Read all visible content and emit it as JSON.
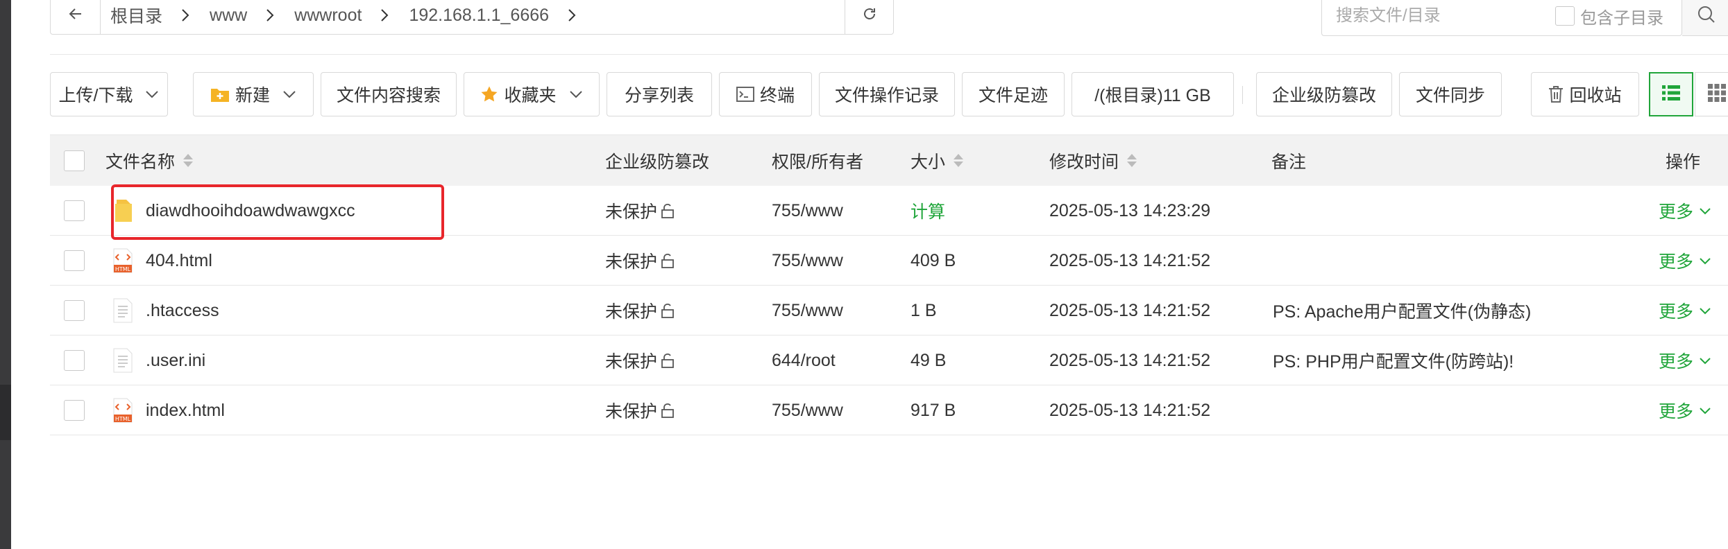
{
  "pathbar": {
    "crumbs": [
      "根目录",
      "www",
      "wwwroot",
      "192.168.1.1_6666"
    ]
  },
  "search": {
    "placeholder": "搜索文件/目录",
    "include_subdir_label": "包含子目录"
  },
  "toolbar": {
    "upload_download": "上传/下载",
    "new": "新建",
    "content_search": "文件内容搜索",
    "favorites": "收藏夹",
    "share_list": "分享列表",
    "terminal": "终端",
    "operation_log": "文件操作记录",
    "footprint": "文件足迹",
    "disk": "/(根目录)11 GB",
    "tamper_proof": "企业级防篡改",
    "sync": "文件同步",
    "recycle_bin": "回收站"
  },
  "table": {
    "headers": {
      "name": "文件名称",
      "tamper": "企业级防篡改",
      "perm": "权限/所有者",
      "size": "大小",
      "mtime": "修改时间",
      "note": "备注",
      "action": "操作"
    },
    "rows": [
      {
        "name": "diawdhooihdoawdwawgxcc",
        "type": "folder",
        "tamper": "未保护",
        "perm": "755/www",
        "size": "计算",
        "mtime": "2025-05-13 14:23:29",
        "note": "",
        "action": "更多"
      },
      {
        "name": "404.html",
        "type": "html",
        "tamper": "未保护",
        "perm": "755/www",
        "size": "409 B",
        "mtime": "2025-05-13 14:21:52",
        "note": "",
        "action": "更多"
      },
      {
        "name": ".htaccess",
        "type": "text",
        "tamper": "未保护",
        "perm": "755/www",
        "size": "1 B",
        "mtime": "2025-05-13 14:21:52",
        "note": "PS: Apache用户配置文件(伪静态)",
        "action": "更多"
      },
      {
        "name": ".user.ini",
        "type": "text",
        "tamper": "未保护",
        "perm": "644/root",
        "size": "49 B",
        "mtime": "2025-05-13 14:21:52",
        "note": "PS: PHP用户配置文件(防跨站)!",
        "action": "更多"
      },
      {
        "name": "index.html",
        "type": "html",
        "tamper": "未保护",
        "perm": "755/www",
        "size": "917 B",
        "mtime": "2025-05-13 14:21:52",
        "note": "",
        "action": "更多"
      }
    ]
  },
  "icons": {
    "back": "arrow-left-icon",
    "refresh": "refresh-icon",
    "search": "search-icon",
    "folder": "folder-icon",
    "html_file": "html-file-icon",
    "text_file": "text-file-icon",
    "lock": "lock-icon"
  },
  "colors": {
    "accent": "#20a53a",
    "highlight": "#e8262b",
    "folder": "#f5c242",
    "html": "#e8612c"
  }
}
